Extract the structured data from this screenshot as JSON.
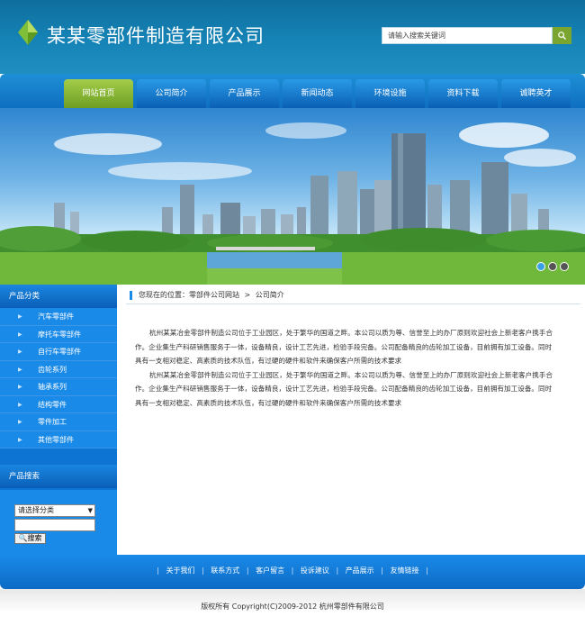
{
  "header": {
    "site_title": "某某零部件制造有限公司",
    "search_placeholder": "请输入搜索关键词"
  },
  "nav": {
    "items": [
      "网站首页",
      "公司简介",
      "产品展示",
      "新闻动态",
      "环境设施",
      "资料下载",
      "诚聘英才"
    ],
    "active": "网站首页"
  },
  "sidebar": {
    "category_heading": "产品分类",
    "categories": [
      "汽车零部件",
      "摩托车零部件",
      "自行车零部件",
      "齿轮系列",
      "轴承系列",
      "结构零件",
      "零件加工",
      "其他零部件"
    ],
    "search_heading": "产品搜索",
    "select_value": "请选择分类",
    "search_button": "搜索"
  },
  "breadcrumb": {
    "prefix": "您现在的位置：零部件公司网站",
    "sep": ">",
    "current": "公司简介"
  },
  "content": {
    "paragraphs": [
      "杭州某某冶金零部件制造公司位于工业园区，处于繁华的国道之畔。本公司以质为尊、信誉至上的办厂原则欢迎社会上新老客户携手合作。企业集生产科研销售服务于一体，设备精良，设计工艺先进，检验手段完备。公司配备精良的齿轮加工设备，目前拥有加工设备。同时具有一支相对稳定、高素质的技术队伍，有过硬的硬件和软件来确保客户所需的技术要求",
      "杭州某某冶金零部件制造公司位于工业园区，处于繁华的国道之畔。本公司以质为尊、信誉至上的办厂原则欢迎社会上新老客户携手合作。企业集生产科研销售服务于一体，设备精良，设计工艺先进，检验手段完备。公司配备精良的齿轮加工设备，目前拥有加工设备。同时具有一支相对稳定、高素质的技术队伍，有过硬的硬件和软件来确保客户所需的技术要求"
    ]
  },
  "footer": {
    "links": [
      "关于我们",
      "联系方式",
      "客户留言",
      "投诉建议",
      "产品展示",
      "友情链接"
    ],
    "separator": "|",
    "copyright": "版权所有  Copyright(C)2009-2012 杭州零部件有限公司"
  },
  "banner": {
    "slides": 3,
    "active_slide": 1
  },
  "colors": {
    "header_bg": "#1683b6",
    "nav_active": "#8dbb3a",
    "sidebar_bg": "#0e74d4",
    "accent": "#1a8ae8"
  },
  "icons": {
    "logo": "logo-mark-icon",
    "search": "magnifier-icon"
  }
}
